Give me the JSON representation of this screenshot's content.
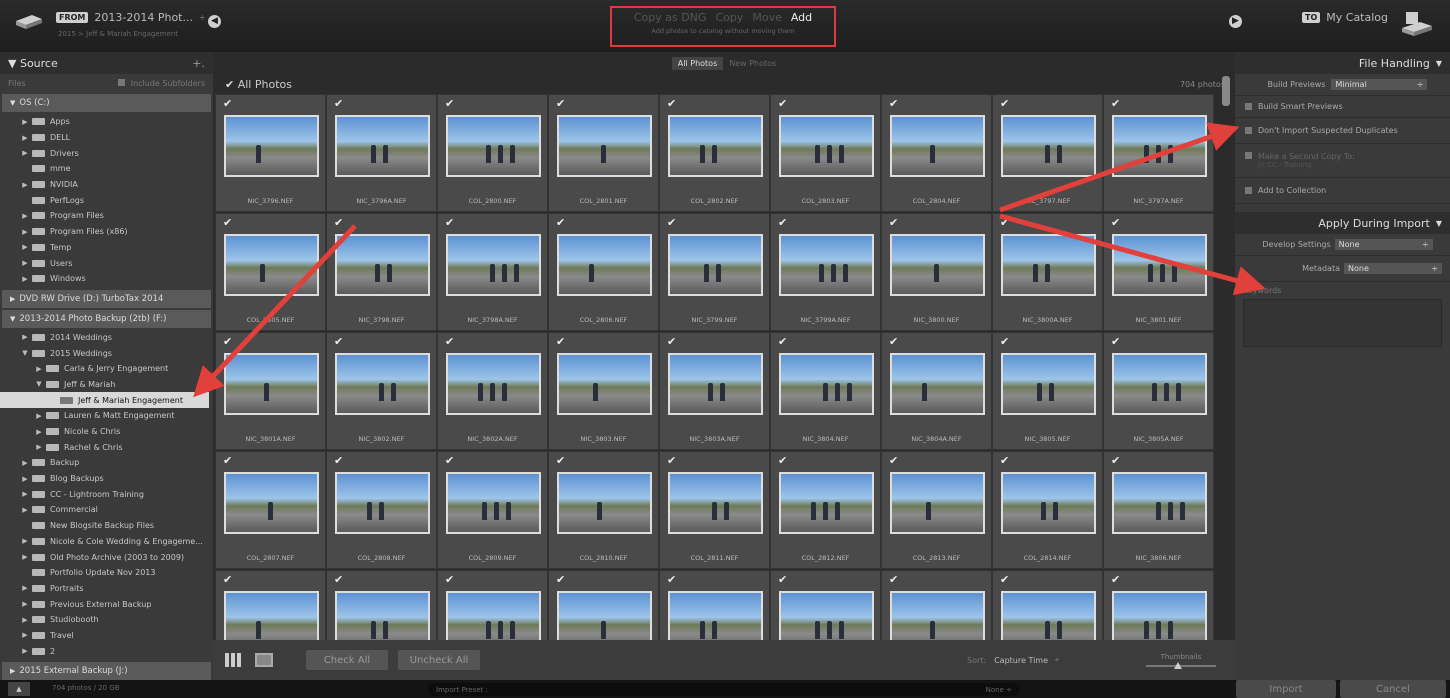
{
  "top": {
    "from_badge": "FROM",
    "source_title": "2013-2014 Phot...",
    "source_sub": "2015 > Jeff & Mariah Engagement",
    "modes": [
      "Copy as DNG",
      "Copy",
      "Move",
      "Add"
    ],
    "mode_desc": "Add photos to catalog without moving them",
    "to_badge": "TO",
    "dest_title": "My Catalog"
  },
  "left": {
    "header": "Source",
    "files_label": "Files",
    "include_sub": "Include Subfolders",
    "vol1": "OS (C:)",
    "c_folders": [
      {
        "name": "Apps",
        "tri": "▶"
      },
      {
        "name": "DELL",
        "tri": "▶"
      },
      {
        "name": "Drivers",
        "tri": "▶"
      },
      {
        "name": "mme",
        "tri": ""
      },
      {
        "name": "NVIDIA",
        "tri": "▶"
      },
      {
        "name": "PerfLogs",
        "tri": ""
      },
      {
        "name": "Program Files",
        "tri": "▶"
      },
      {
        "name": "Program Files (x86)",
        "tri": "▶"
      },
      {
        "name": "Temp",
        "tri": "▶"
      },
      {
        "name": "Users",
        "tri": "▶"
      },
      {
        "name": "Windows",
        "tri": "▶"
      }
    ],
    "vol2": "DVD RW Drive (D:) TurboTax 2014",
    "vol3": "2013-2014 Photo Backup (2tb) (F:)",
    "f_folders": [
      {
        "name": "2014 Weddings",
        "tri": "▶",
        "indent": 0
      },
      {
        "name": "2015 Weddings",
        "tri": "▼",
        "indent": 0
      },
      {
        "name": "Carla & Jerry Engagement",
        "tri": "▶",
        "indent": 1
      },
      {
        "name": "Jeff & Mariah",
        "tri": "▼",
        "indent": 1
      },
      {
        "name": "Jeff & Mariah Engagement",
        "tri": "",
        "indent": 2,
        "sel": true
      },
      {
        "name": "Lauren & Matt Engagement",
        "tri": "▶",
        "indent": 1
      },
      {
        "name": "Nicole & Chris",
        "tri": "▶",
        "indent": 1
      },
      {
        "name": "Rachel & Chris",
        "tri": "▶",
        "indent": 1
      },
      {
        "name": "Backup",
        "tri": "▶",
        "indent": 0
      },
      {
        "name": "Blog Backups",
        "tri": "▶",
        "indent": 0
      },
      {
        "name": "CC - Lightroom Training",
        "tri": "▶",
        "indent": 0
      },
      {
        "name": "Commercial",
        "tri": "▶",
        "indent": 0
      },
      {
        "name": "New Blogsite Backup Files",
        "tri": "",
        "indent": 0
      },
      {
        "name": "Nicole & Cole Wedding & Engageme...",
        "tri": "▶",
        "indent": 0
      },
      {
        "name": "Old Photo Archive (2003 to 2009)",
        "tri": "▶",
        "indent": 0
      },
      {
        "name": "Portfolio Update Nov 2013",
        "tri": "",
        "indent": 0
      },
      {
        "name": "Portraits",
        "tri": "▶",
        "indent": 0
      },
      {
        "name": "Previous External Backup",
        "tri": "▶",
        "indent": 0
      },
      {
        "name": "Studiobooth",
        "tri": "▶",
        "indent": 0
      },
      {
        "name": "Travel",
        "tri": "▶",
        "indent": 0
      },
      {
        "name": "2",
        "tri": "▶",
        "indent": 0
      }
    ],
    "vol4": "2015 External Backup (J:)"
  },
  "center": {
    "tab_all": "All Photos",
    "tab_new": "New Photos",
    "all_photos_label": "All Photos",
    "count": "704 photos",
    "filenames": [
      "NIC_3796.NEF",
      "NIC_3796A.NEF",
      "COL_2800.NEF",
      "COL_2801.NEF",
      "COL_2802.NEF",
      "COL_2803.NEF",
      "COL_2804.NEF",
      "NIC_3797.NEF",
      "NIC_3797A.NEF",
      "COL_2805.NEF",
      "NIC_3798.NEF",
      "NIC_3798A.NEF",
      "COL_2806.NEF",
      "NIC_3799.NEF",
      "NIC_3799A.NEF",
      "NIC_3800.NEF",
      "NIC_3800A.NEF",
      "NIC_3801.NEF",
      "NIC_3801A.NEF",
      "NIC_3802.NEF",
      "NIC_3802A.NEF",
      "NIC_3803.NEF",
      "NIC_3803A.NEF",
      "NIC_3804.NEF",
      "NIC_3804A.NEF",
      "NIC_3805.NEF",
      "NIC_3805A.NEF",
      "COL_2807.NEF",
      "COL_2808.NEF",
      "COL_2809.NEF",
      "COL_2810.NEF",
      "COL_2811.NEF",
      "COL_2812.NEF",
      "COL_2813.NEF",
      "COL_2814.NEF",
      "NIC_3806.NEF",
      "",
      "",
      "",
      "",
      "",
      "",
      "",
      "",
      ""
    ],
    "check_all": "Check All",
    "uncheck_all": "Uncheck All",
    "sort_label": "Sort:",
    "sort_value": "Capture Time",
    "thumbnails_label": "Thumbnails"
  },
  "right": {
    "file_handling": "File Handling",
    "build_previews_label": "Build Previews",
    "build_previews_value": "Minimal",
    "smart_previews": "Build Smart Previews",
    "dont_import": "Don't Import Suspected Duplicates",
    "second_copy": "Make a Second Copy To:",
    "second_copy_path": "J:\\ CC - Training",
    "add_collection": "Add to Collection",
    "apply_header": "Apply During Import",
    "develop_label": "Develop Settings",
    "develop_value": "None",
    "metadata_label": "Metadata",
    "metadata_value": "None",
    "keywords_label": "Keywords"
  },
  "bottom": {
    "status": "704 photos / 20 GB",
    "preset_label": "Import Preset :",
    "preset_value": "None ÷",
    "import": "Import",
    "cancel": "Cancel"
  },
  "colors": {
    "arrow": "#e2403a",
    "panel": "#3a3a3a",
    "center": "#2b2b2b"
  }
}
